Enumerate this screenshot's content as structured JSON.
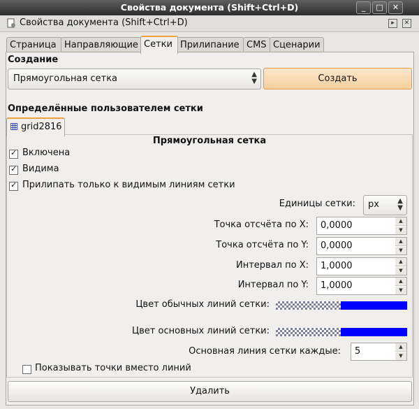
{
  "window": {
    "title": "Свойства документа (Shift+Ctrl+D)"
  },
  "dock": {
    "title": "Свойства документа (Shift+Ctrl+D)"
  },
  "tabs": [
    "Страница",
    "Направляющие",
    "Сетки",
    "Прилипание",
    "CMS",
    "Сценарии"
  ],
  "active_tab": "Сетки",
  "create_section": {
    "heading": "Создание",
    "grid_type": "Прямоугольная сетка",
    "create_button": "Создать"
  },
  "user_grids": {
    "heading": "Определённые пользователем сетки",
    "grid_tab": "grid2816",
    "panel_title": "Прямоугольная сетка",
    "enabled_label": "Включена",
    "visible_label": "Видима",
    "snap_visible_label": "Прилипать только к видимым линиям сетки",
    "units_label": "Единицы сетки:",
    "units_value": "px",
    "origin_x_label": "Точка отсчёта по X:",
    "origin_x_value": "0,0000",
    "origin_y_label": "Точка отсчёта по Y:",
    "origin_y_value": "0,0000",
    "spacing_x_label": "Интервал по X:",
    "spacing_x_value": "1,0000",
    "spacing_y_label": "Интервал по Y:",
    "spacing_y_value": "1,0000",
    "minor_color_label": "Цвет обычных линий сетки:",
    "major_color_label": "Цвет основных линий сетки:",
    "major_every_label": "Основная линия сетки каждые:",
    "major_every_value": "5",
    "dots_label": "Показывать точки вместо линий",
    "delete_button": "Удалить"
  },
  "colors": {
    "grid_minor": "#0000ff",
    "grid_major": "#0000ff",
    "accent": "#f0a040"
  }
}
